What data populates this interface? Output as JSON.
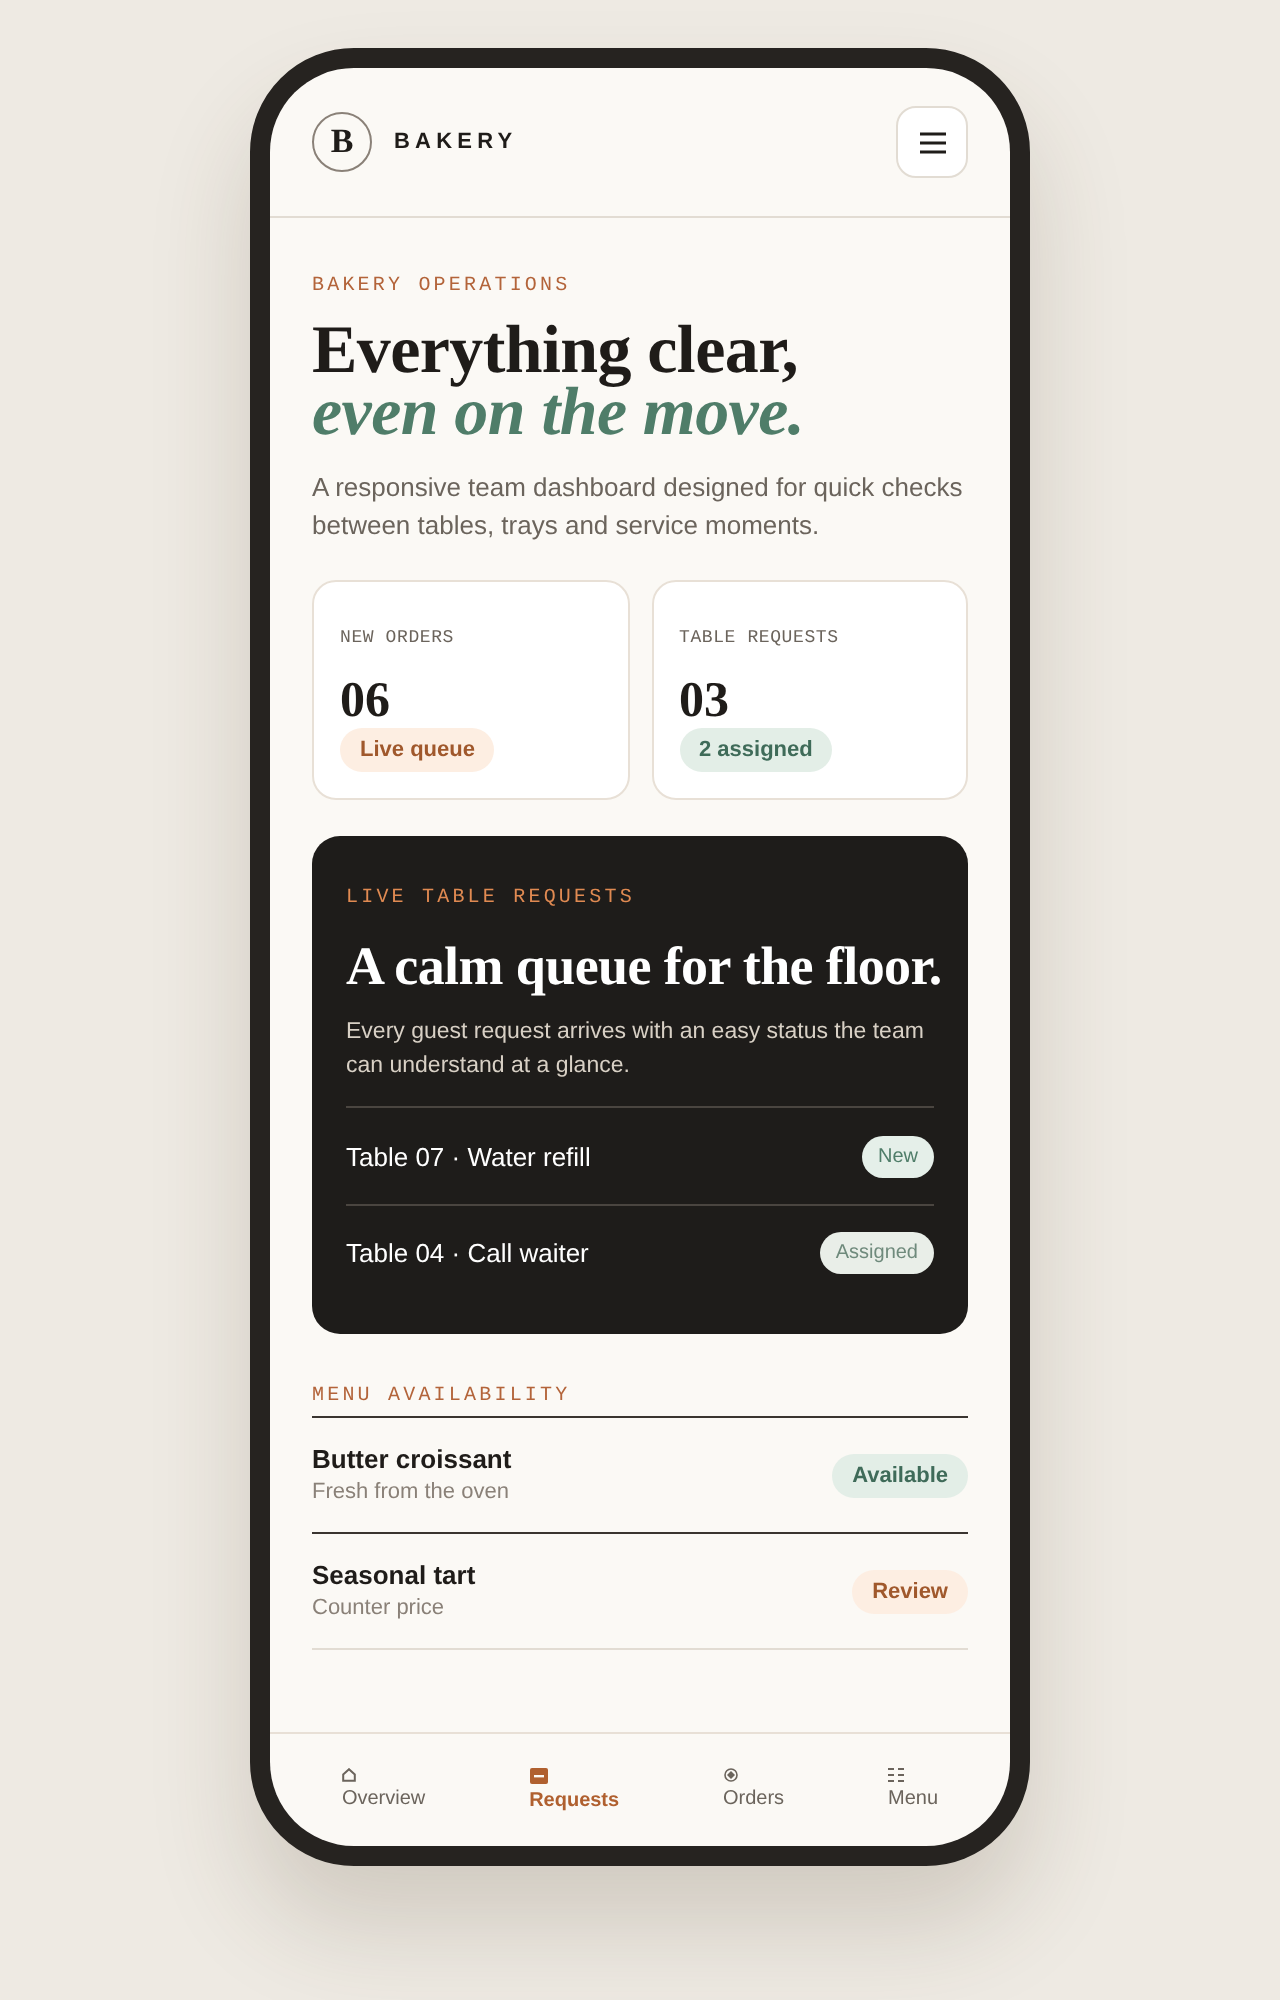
{
  "header": {
    "logo": "B",
    "brand": "BAKERY"
  },
  "hero": {
    "eyebrow": "BAKERY OPERATIONS",
    "title": "Everything clear,",
    "title_accent": "even on the move.",
    "description": "A responsive team dashboard designed for quick checks between tables, trays and service moments."
  },
  "stats": [
    {
      "label": "NEW ORDERS",
      "value": "06",
      "badge": {
        "text": "Live queue",
        "kind": "warm"
      }
    },
    {
      "label": "TABLE REQUESTS",
      "value": "03",
      "badge": {
        "text": "2 assigned",
        "kind": "green"
      }
    }
  ],
  "live_requests": {
    "eyebrow": "LIVE TABLE REQUESTS",
    "title": "A calm queue for the floor.",
    "description": "Every guest request arrives with an easy status the team can understand at a glance.",
    "requests": [
      {
        "text": "Table 07 · Water refill",
        "status": "New",
        "kind": "new"
      },
      {
        "text": "Table 04 · Call waiter",
        "status": "Assigned",
        "kind": "assigned"
      }
    ]
  },
  "menu_availability": {
    "title": "MENU AVAILABILITY",
    "items": [
      {
        "name": "Butter croissant",
        "note": "Fresh from the oven",
        "status": "Available",
        "kind": "green"
      },
      {
        "name": "Seasonal tart",
        "note": "Counter price",
        "status": "Review",
        "kind": "warm"
      }
    ]
  },
  "bottom_nav": [
    {
      "label": "Overview",
      "selected": false
    },
    {
      "label": "Requests",
      "selected": true
    },
    {
      "label": "Orders",
      "selected": false
    },
    {
      "label": "Menu",
      "selected": false
    }
  ]
}
